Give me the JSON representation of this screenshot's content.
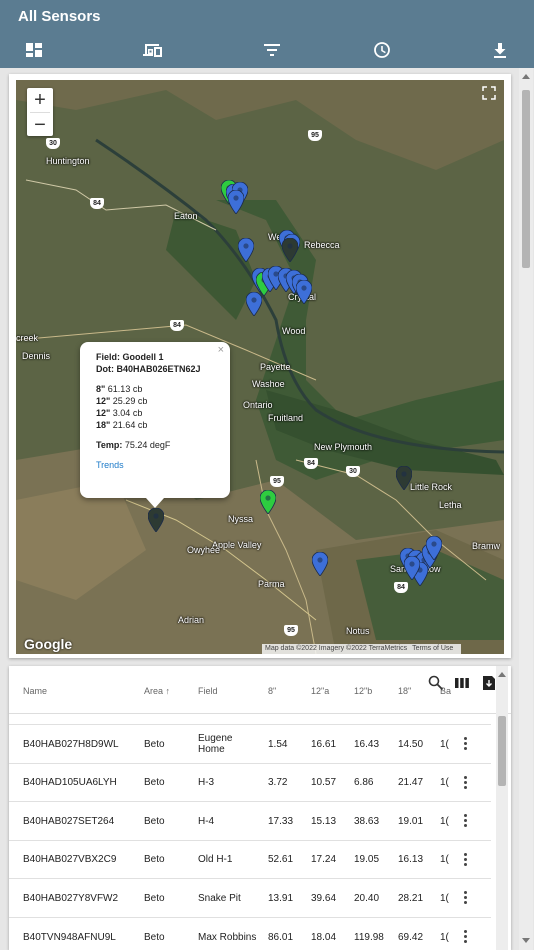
{
  "app": {
    "title": "All Sensors"
  },
  "toolbar": {
    "buttons": [
      "dashboard-icon",
      "devices-icon",
      "filter-icon",
      "history-icon",
      "download-icon"
    ]
  },
  "map": {
    "zoom_in": "+",
    "zoom_out": "−",
    "places": [
      "Huntington",
      "Eaton",
      "Weiser",
      "Rebecca",
      "Crystal",
      "Wood",
      "creek",
      "Dennis",
      "Payette",
      "Washoe",
      "Ontario",
      "Fruitland",
      "New Plymouth",
      "Little Rock",
      "Letha",
      "Bramw",
      "Nyssa",
      "Apple Valley",
      "Owyhee",
      "Parma",
      "Sand Hollow",
      "Adrian",
      "Notus"
    ],
    "road_shields": [
      "30",
      "84",
      "95",
      "84",
      "84",
      "30",
      "95",
      "95",
      "84"
    ],
    "google_logo": "Google",
    "attribution": [
      "Map data ©2022 Imagery ©2022 TerraMetrics",
      "Terms of Use"
    ],
    "popup": {
      "field_label": "Field:",
      "field_value": "Goodell 1",
      "dot_label": "Dot:",
      "dot_value": "B40HAB026ETN62J",
      "readings": [
        {
          "depth": "8\"",
          "value": "61.13 cb"
        },
        {
          "depth": "12\"",
          "value": "25.29 cb"
        },
        {
          "depth": "12\"",
          "value": "3.04 cb"
        },
        {
          "depth": "18\"",
          "value": "21.64 cb"
        }
      ],
      "temp_label": "Temp:",
      "temp_value": "75.24 degF",
      "link": "Trends",
      "close": "×"
    },
    "colors": {
      "blue_pin": "#3d6fd8",
      "green_pin": "#2ecc40",
      "dark_pin": "#2d3a33"
    }
  },
  "table": {
    "columns": [
      "Name",
      "Area",
      "Field",
      "8\"",
      "12\"a",
      "12\"b",
      "18\"",
      "Ba"
    ],
    "sort_icon": "↑",
    "rows": [
      {
        "name": "B40HAB027H8D9WL",
        "area": "Beto",
        "field": "Eugene Home",
        "v8": "1.54",
        "v12a": "16.61",
        "v12b": "16.43",
        "v18": "14.50",
        "ba": "1("
      },
      {
        "name": "B40HAD105UA6LYH",
        "area": "Beto",
        "field": "H-3",
        "v8": "3.72",
        "v12a": "10.57",
        "v12b": "6.86",
        "v18": "21.47",
        "ba": "1("
      },
      {
        "name": "B40HAB027SET264",
        "area": "Beto",
        "field": "H-4",
        "v8": "17.33",
        "v12a": "15.13",
        "v12b": "38.63",
        "v18": "19.01",
        "ba": "1("
      },
      {
        "name": "B40HAB027VBX2C9",
        "area": "Beto",
        "field": "Old H-1",
        "v8": "52.61",
        "v12a": "17.24",
        "v12b": "19.05",
        "v18": "16.13",
        "ba": "1("
      },
      {
        "name": "B40HAB027Y8VFW2",
        "area": "Beto",
        "field": "Snake Pit",
        "v8": "13.91",
        "v12a": "39.64",
        "v12b": "20.40",
        "v18": "28.21",
        "ba": "1("
      },
      {
        "name": "B40TVN948AFNU9L",
        "area": "Beto",
        "field": "Max Robbins",
        "v8": "86.01",
        "v12a": "18.04",
        "v12b": "119.98",
        "v18": "69.42",
        "ba": "1("
      }
    ]
  }
}
